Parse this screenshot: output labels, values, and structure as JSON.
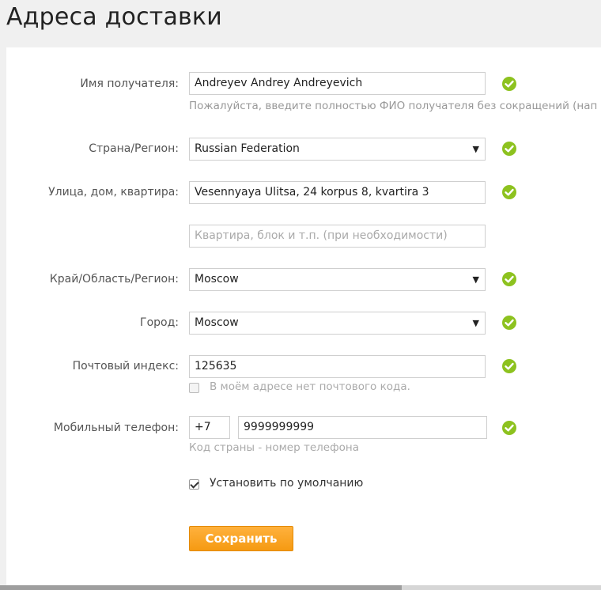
{
  "page": {
    "title": "Адреса доставки"
  },
  "form": {
    "recipient": {
      "label": "Имя получателя:",
      "value": "Andreyev Andrey Andreyevich",
      "hint": "Пожалуйста, введите полностью ФИО получателя без сокращений (нап"
    },
    "country": {
      "label": "Страна/Регион:",
      "value": "Russian Federation"
    },
    "street": {
      "label": "Улица, дом, квартира:",
      "value": "Vesennyaya Ulitsa, 24 korpus 8, kvartira 3"
    },
    "apartment": {
      "placeholder": "Квартира, блок и т.п. (при необходимости)"
    },
    "region": {
      "label": "Край/Область/Регион:",
      "value": "Moscow"
    },
    "city": {
      "label": "Город:",
      "value": "Moscow"
    },
    "postal": {
      "label": "Почтовый индекс:",
      "value": "125635",
      "no_code_label": "В моём адресе нет почтового кода."
    },
    "phone": {
      "label": "Мобильный телефон:",
      "country_code": "+7",
      "number": "9999999999",
      "hint": "Код страны - номер телефона"
    },
    "default": {
      "label": "Установить по умолчанию",
      "checked": true
    },
    "save_label": "Сохранить"
  },
  "icons": {
    "valid": "check-circle-icon",
    "dropdown": "triangle-down-icon"
  },
  "colors": {
    "valid_green": "#8dc21f",
    "button_orange": "#f7a11d"
  }
}
